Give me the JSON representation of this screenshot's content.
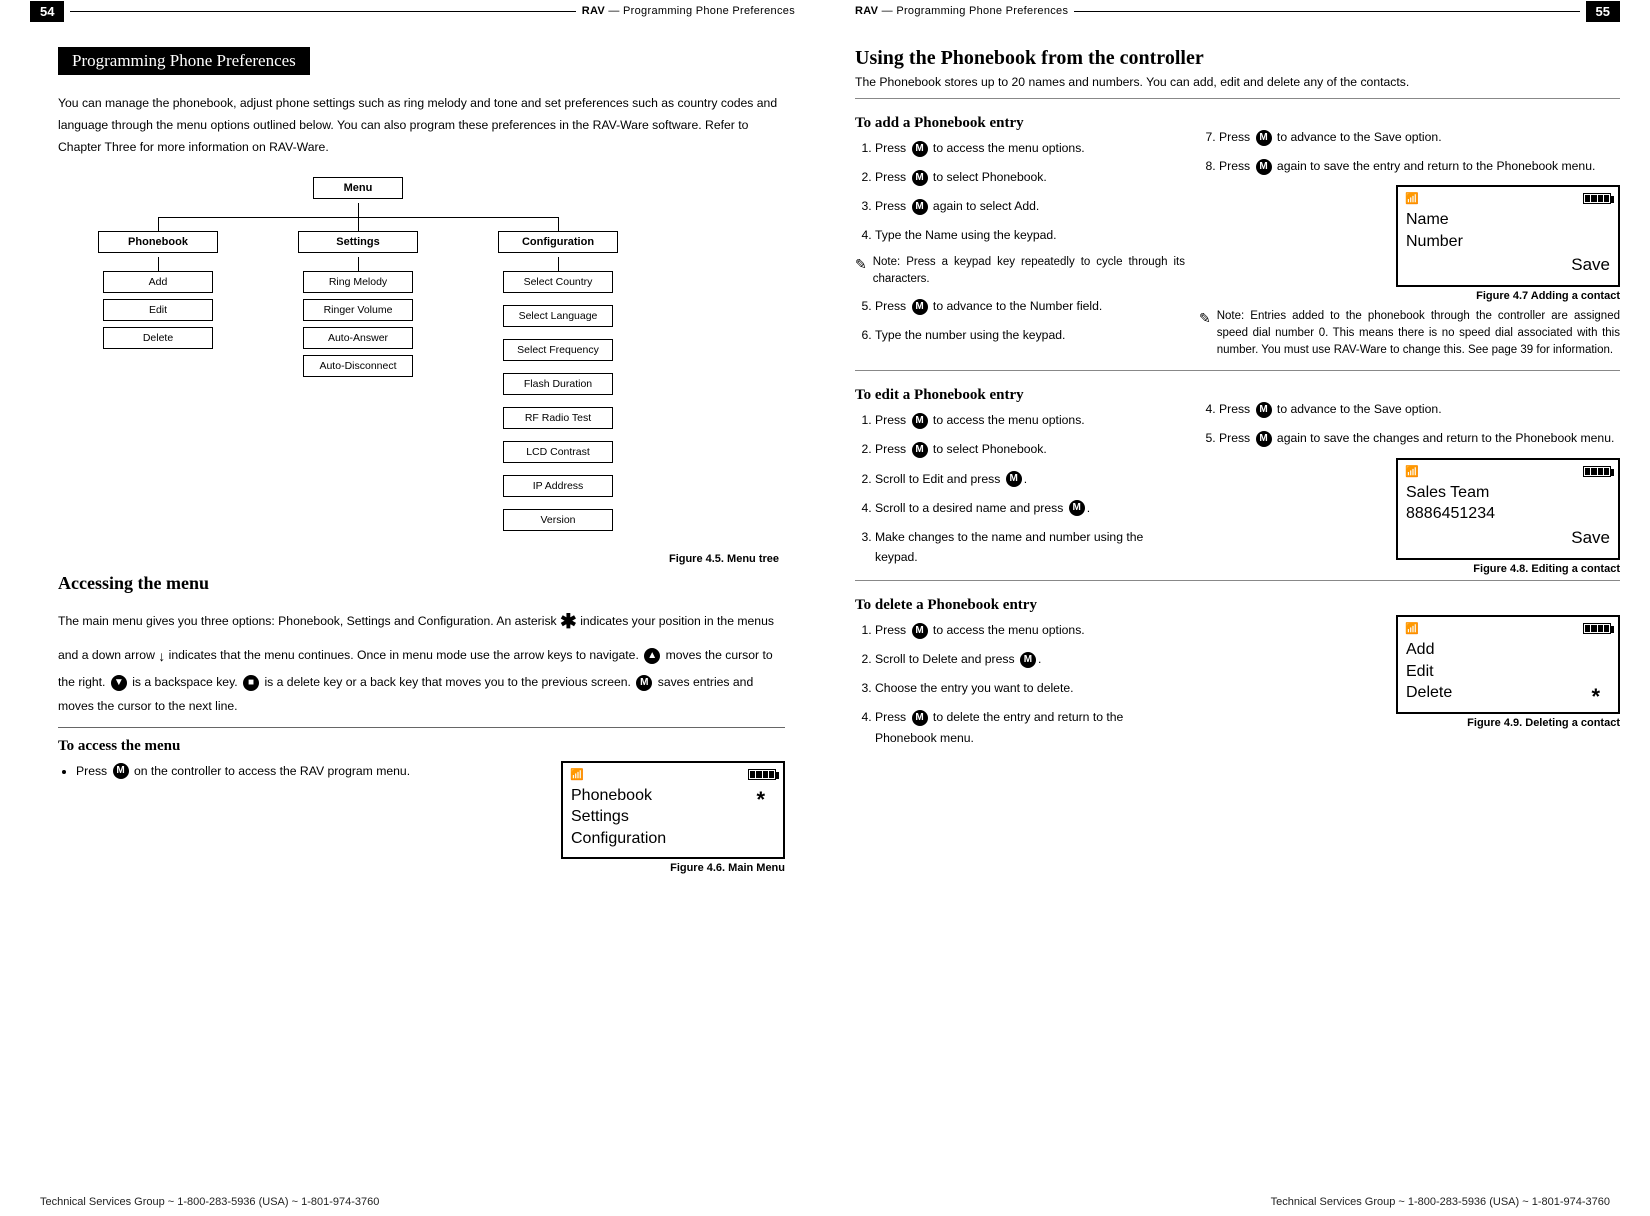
{
  "page_left": {
    "page_num": "54",
    "header_prefix": "RAV",
    "header_title": " — Programming Phone Preferences",
    "section_bar": "Programming Phone Preferences",
    "intro": "You can manage the phonebook, adjust phone settings such as ring melody and tone and set preferences such as country codes and language through the menu options outlined below. You can also program these preferences in the RAV-Ware software. Refer to Chapter Three for more information on RAV-Ware.",
    "tree": {
      "root": "Menu",
      "cols": [
        {
          "head": "Phonebook",
          "items": [
            "Add",
            "Edit",
            "Delete"
          ]
        },
        {
          "head": "Settings",
          "items": [
            "Ring Melody",
            "Ringer Volume",
            "Auto-Answer",
            "Auto-Disconnect"
          ]
        },
        {
          "head": "Configuration",
          "items": [
            "Select Country",
            "Select Language",
            "Select Frequency",
            "Flash Duration",
            "RF Radio Test",
            "LCD Contrast",
            "IP Address",
            "Version"
          ]
        }
      ]
    },
    "fig45": "Figure 4.5. Menu tree",
    "h2_access": "Accessing the menu",
    "access_para_1a": "The main menu gives you three options: Phonebook, Settings and Configuration. An asterisk ",
    "access_para_1b": " indicates your position in the menus and a down arrow ",
    "access_para_1c": " indicates that the menu continues. Once in menu mode use the arrow keys to navigate. ",
    "access_para_1d": " moves the cursor to the right. ",
    "access_para_1e": " is a backspace key. ",
    "access_para_1f": " is a delete key or a back key that moves you to the previous screen. ",
    "access_para_1g": " saves entries and moves the cursor to the next line.",
    "h3_toaccess": "To access the menu",
    "bullet1a": "Press ",
    "bullet1b": " on the controller to access the RAV program menu.",
    "lcd1": {
      "l1": "Phonebook",
      "l2": "Settings",
      "l3": "Configuration"
    },
    "fig46": "Figure 4.6. Main Menu",
    "footer": "Technical Services Group ~ 1-800-283-5936 (USA) ~ 1-801-974-3760"
  },
  "page_right": {
    "page_num": "55",
    "header_prefix": "RAV",
    "header_title": " — Programming Phone Preferences",
    "h1": "Using the Phonebook from the controller",
    "intro": "The Phonebook stores up to 20 names and numbers. You can add, edit and delete any of the contacts.",
    "add": {
      "title": "To add a Phonebook entry",
      "s1a": "Press ",
      "s1b": " to access the menu options.",
      "s2a": "Press ",
      "s2b": " to select Phonebook.",
      "s3a": "Press ",
      "s3b": " again to select Add.",
      "s4": "Type the Name using the keypad.",
      "note1": "Note: Press a keypad key repeatedly to cycle through its characters.",
      "s5a": "Press ",
      "s5b": " to advance to the Number field.",
      "s6": "Type the number using the keypad.",
      "s7a": "Press ",
      "s7b": " to advance to the Save option.",
      "s8a": "Press ",
      "s8b": " again to save the entry and return to the Phonebook menu.",
      "lcd": {
        "l1": "Name",
        "l2": "Number",
        "save": "Save"
      },
      "figcap": "Figure 4.7 Adding a contact",
      "note2": "Note: Entries added to the phonebook through the controller are assigned speed dial number 0. This means there is no speed dial associated with this number. You must use RAV-Ware to change this. See page 39 for information."
    },
    "edit": {
      "title": "To edit a Phonebook entry",
      "s1a": "Press ",
      "s1b": " to access the menu options.",
      "s2a": "Press ",
      "s2b": " to select Phonebook.",
      "s2c": "Scroll to Edit and press ",
      "s4": "Scroll to a desired name and press ",
      "s3": "Make changes to the name and number using the keypad.",
      "r4a": "Press ",
      "r4b": " to advance to the Save option.",
      "r5a": "Press ",
      "r5b": " again to save the changes and return to the Phonebook menu.",
      "lcd": {
        "l1": "Sales Team",
        "l2": "8886451234",
        "save": "Save"
      },
      "figcap": "Figure 4.8. Editing a contact"
    },
    "del": {
      "title": "To delete a Phonebook entry",
      "s1a": "Press ",
      "s1b": " to access the menu options.",
      "s2": "Scroll to Delete and press ",
      "s3": "Choose the entry you want to delete.",
      "s4a": "Press ",
      "s4b": " to delete the entry and return to the Phonebook menu.",
      "lcd": {
        "l1": "Add",
        "l2": "Edit",
        "l3": "Delete"
      },
      "figcap": "Figure 4.9. Deleting a contact"
    },
    "footer": "Technical Services Group ~ 1-800-283-5936 (USA) ~ 1-801-974-3760"
  }
}
